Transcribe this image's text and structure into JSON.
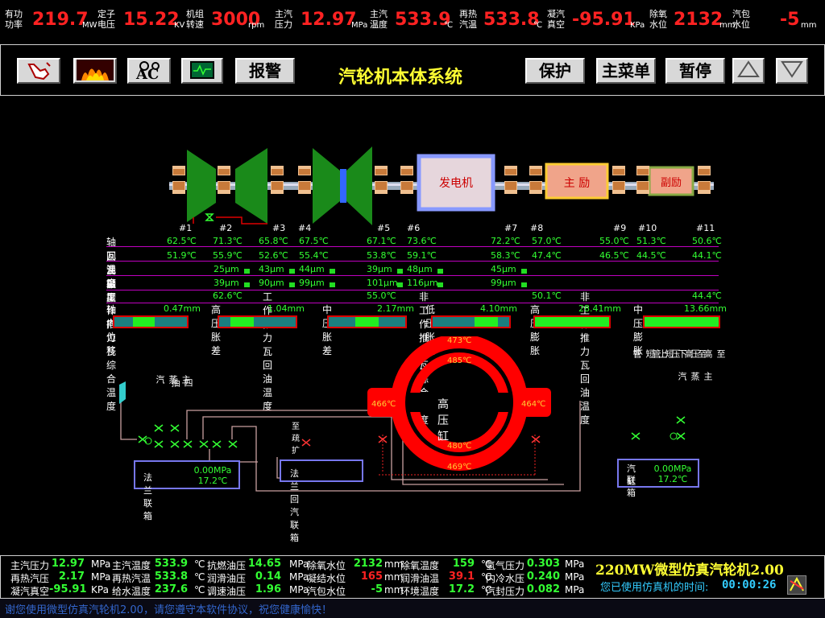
{
  "topbar": [
    {
      "label1": "有功",
      "label2": "功率",
      "value": "219.7",
      "unit": "MW"
    },
    {
      "label1": "定子",
      "label2": "电压",
      "value": "15.22",
      "unit": "KV"
    },
    {
      "label1": "机组",
      "label2": "转速",
      "value": "3000",
      "unit": "rpm"
    },
    {
      "label1": "主汽",
      "label2": "压力",
      "value": "12.97",
      "unit": "MPa"
    },
    {
      "label1": "主汽",
      "label2": "温度",
      "value": "533.9",
      "unit": "℃"
    },
    {
      "label1": "再热",
      "label2": "汽温",
      "value": "533.8",
      "unit": "℃"
    },
    {
      "label1": "凝汽",
      "label2": "真空",
      "value": "-95.91",
      "unit": "KPa"
    },
    {
      "label1": "除氧",
      "label2": "水位",
      "value": "2132",
      "unit": "mm"
    },
    {
      "label1": "汽包",
      "label2": "水位",
      "value": "-5",
      "unit": "mm"
    }
  ],
  "toolbar": {
    "alarm": "报警",
    "title": "汽轮机本体系统",
    "protect": "保护",
    "main_menu": "主菜单",
    "pause": "暂停",
    "icons": [
      "hand-pointer-icon",
      "fire-icon",
      "abc-settings-icon",
      "monitor-wave-icon",
      "triangle-up-icon",
      "triangle-down-icon"
    ]
  },
  "machine": {
    "generator": "发电机",
    "main_exciter": "主 励",
    "aux_exciter": "副励",
    "bearings": [
      "#1",
      "#2",
      "#3",
      "#4",
      "#5",
      "#6",
      "#7",
      "#8",
      "#9",
      "#10",
      "#11"
    ]
  },
  "table": {
    "row_labels": [
      "轴瓦温度",
      "回油温度",
      "瓦   振",
      "轴   振"
    ],
    "bearing_temp": [
      "62.5℃",
      "71.3℃",
      "65.8℃",
      "67.5℃",
      "67.1℃",
      "73.6℃",
      "72.2℃",
      "57.0℃",
      "55.0℃",
      "51.3℃",
      "50.6℃"
    ],
    "oil_return": [
      "51.9℃",
      "55.9℃",
      "52.6℃",
      "55.4℃",
      "53.8℃",
      "59.1℃",
      "58.3℃",
      "47.4℃",
      "46.5℃",
      "44.5℃",
      "44.1℃"
    ],
    "pad_vib": [
      "25μm",
      "43μm",
      "44μm",
      "39μm",
      "48μm",
      "45μm"
    ],
    "shaft_vib": [
      "39μm",
      "90μm",
      "99μm",
      "101μm",
      "116μm",
      "99μm"
    ],
    "thrust1_label": "工作推力瓦综合温度",
    "thrust1_val": "62.6℃",
    "thrust2_label": "工作推力瓦回油温度",
    "thrust2_val": "55.0℃",
    "thrust3_label": "非工作推力瓦综合温度",
    "thrust3_val": "50.1℃",
    "thrust4_label": "非工作推力瓦回油温度",
    "thrust4_val": "44.4℃",
    "measures": [
      {
        "label": "轴向位移",
        "value": "0.47mm",
        "fill": 0.4
      },
      {
        "label": "高压胀差",
        "value": "1.04mm",
        "fill": 0.3
      },
      {
        "label": "中压胀差",
        "value": "2.17mm",
        "fill": 0.5
      },
      {
        "label": "低压胀差",
        "value": "4.10mm",
        "fill": 0.7
      },
      {
        "label": "高压膨胀",
        "value": "28.41mm",
        "fill": 1.0
      },
      {
        "label": "中压膨胀",
        "value": "13.66mm",
        "fill": 1.0
      }
    ]
  },
  "hp_cylinder": {
    "title": "高压缸",
    "temps": {
      "top_outer": "473℃",
      "top_inner": "485℃",
      "left": "466℃",
      "right": "464℃",
      "bottom_inner": "480℃",
      "bottom_outer": "469℃"
    }
  },
  "flange": {
    "left_name": "法兰联箱",
    "left_pressure": "0.00MPa",
    "left_temp": "17.2℃",
    "mid_name": "法兰回汽联箱",
    "to_expander": "至疏扩",
    "right_name1": "汽缸",
    "right_name2": "联箱",
    "right_pressure": "0.00MPa",
    "right_temp": "17.2℃",
    "v_main_steam": "主蒸汽",
    "v_four_extract": "四抽",
    "v_to_hp_upper": "至高压上短管",
    "v_to_hp_lower": "至高压下短管",
    "v_main_steam_r": "主蒸汽"
  },
  "bottom": {
    "rows": [
      [
        {
          "l": "主汽压力",
          "v": "12.97",
          "u": "MPa"
        },
        {
          "l": "主汽温度",
          "v": "533.9",
          "u": "℃"
        },
        {
          "l": "抗燃油压",
          "v": "14.65",
          "u": "MPa"
        },
        {
          "l": "除氧水位",
          "v": "2132",
          "u": "mm"
        },
        {
          "l": "除氧温度",
          "v": "159",
          "u": "℃"
        },
        {
          "l": "氢气压力",
          "v": "0.303",
          "u": "MPa"
        }
      ],
      [
        {
          "l": "再热汽压",
          "v": "2.17",
          "u": "MPa"
        },
        {
          "l": "再热汽温",
          "v": "533.8",
          "u": "℃"
        },
        {
          "l": "润滑油压",
          "v": "0.14",
          "u": "MPa"
        },
        {
          "l": "凝结水位",
          "v": "165",
          "u": "mm"
        },
        {
          "l": "润滑油温",
          "v": "39.1",
          "u": "℃"
        },
        {
          "l": "内冷水压",
          "v": "0.240",
          "u": "MPa"
        }
      ],
      [
        {
          "l": "凝汽真空",
          "v": "-95.91",
          "u": "KPa"
        },
        {
          "l": "给水温度",
          "v": "237.6",
          "u": "℃"
        },
        {
          "l": "调速油压",
          "v": "1.96",
          "u": "MPa"
        },
        {
          "l": "汽包水位",
          "v": "-5",
          "u": "mm"
        },
        {
          "l": "环境温度",
          "v": "17.2",
          "u": "℃"
        },
        {
          "l": "汽封压力",
          "v": "0.082",
          "u": "MPa"
        }
      ]
    ],
    "red_values": [
      "165",
      "39.1"
    ],
    "app_title": "220MW微型仿真汽轮机2.00",
    "timer_label": "您已使用仿真机的时间:",
    "timer": "00:00:26"
  },
  "footer": "谢您使用微型仿真汽轮机2.00，请您遵守本软件协议，祝您健康愉快！"
}
